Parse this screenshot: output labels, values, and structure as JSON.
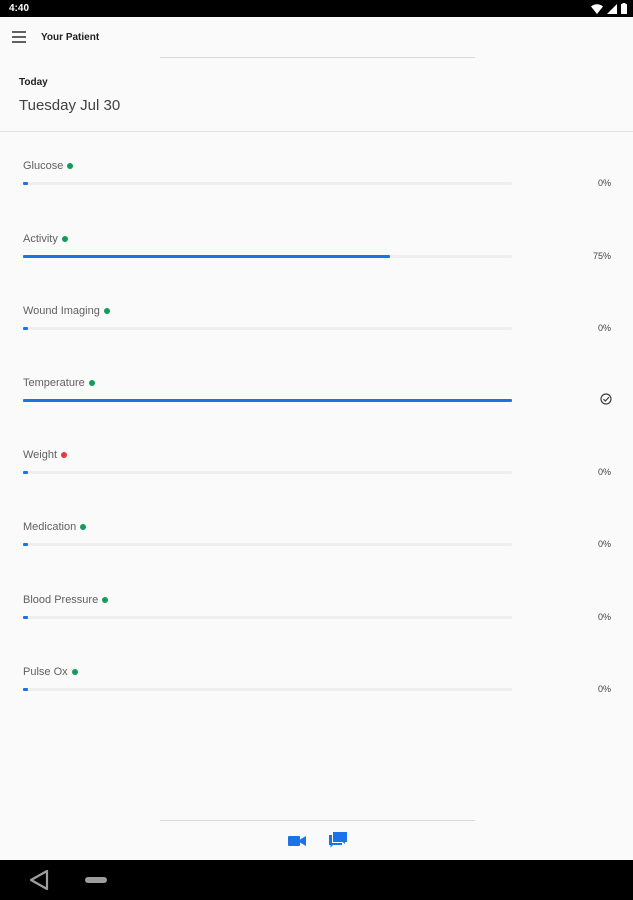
{
  "status_bar": {
    "time": "4:40"
  },
  "app_bar": {
    "title": "Your Patient"
  },
  "header": {
    "today_label": "Today",
    "date": "Tuesday Jul 30"
  },
  "metrics": [
    {
      "label": "Glucose",
      "value": "0%",
      "progress": 0.01,
      "status": "ok",
      "dot_color": "#0f9d58"
    },
    {
      "label": "Activity",
      "value": "75%",
      "progress": 0.75,
      "status": "ok",
      "dot_color": "#0f9d58"
    },
    {
      "label": "Wound Imaging",
      "value": "0%",
      "progress": 0.01,
      "status": "ok",
      "dot_color": "#0f9d58"
    },
    {
      "label": "Temperature",
      "value": "",
      "progress": 1.0,
      "status": "complete",
      "dot_color": "#0f9d58",
      "icon": "check-circle-icon"
    },
    {
      "label": "Weight",
      "value": "0%",
      "progress": 0.01,
      "status": "alert",
      "dot_color": "#e53935"
    },
    {
      "label": "Medication",
      "value": "0%",
      "progress": 0.01,
      "status": "ok",
      "dot_color": "#0f9d58"
    },
    {
      "label": "Blood Pressure",
      "value": "0%",
      "progress": 0.01,
      "status": "ok",
      "dot_color": "#0f9d58"
    },
    {
      "label": "Pulse Ox",
      "value": "0%",
      "progress": 0.01,
      "status": "ok",
      "dot_color": "#0f9d58"
    }
  ],
  "bottom_actions": {
    "video_icon": "video-call-icon",
    "chat_icon": "chat-icon"
  },
  "colors": {
    "accent": "#1a73e8",
    "ok": "#0f9d58",
    "alert": "#e53935",
    "track": "#eeeeee"
  }
}
